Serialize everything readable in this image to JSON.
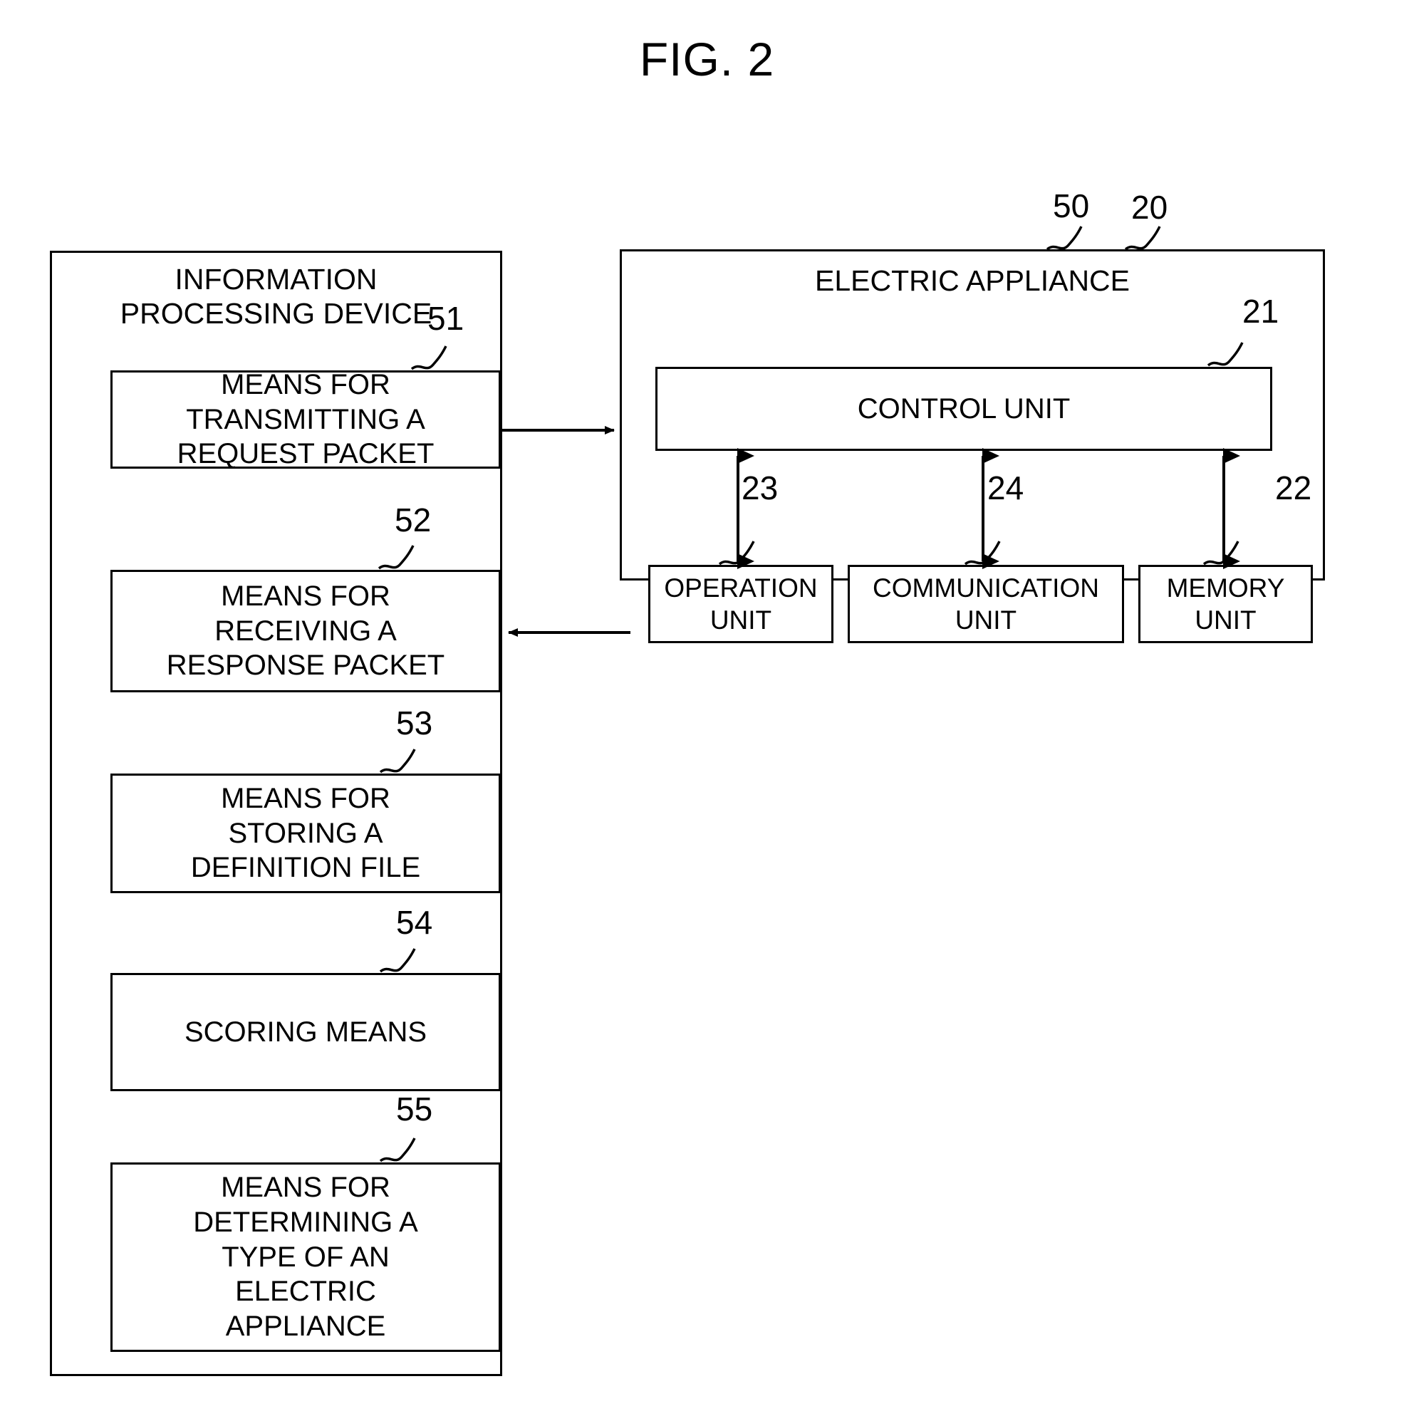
{
  "figure": {
    "title": "FIG. 2",
    "type": "patent-block-diagram"
  },
  "left_panel": {
    "ref": "50",
    "title": "INFORMATION\nPROCESSING DEVICE",
    "boxes": [
      {
        "ref": "51",
        "label": "MEANS FOR\nTRANSMITTING A\nREQUEST PACKET"
      },
      {
        "ref": "52",
        "label": "MEANS FOR\nRECEIVING A\nRESPONSE PACKET"
      },
      {
        "ref": "53",
        "label": "MEANS FOR\nSTORING A\nDEFINITION FILE"
      },
      {
        "ref": "54",
        "label": "SCORING MEANS"
      },
      {
        "ref": "55",
        "label": "MEANS FOR\nDETERMINING A\nTYPE OF AN\nELECTRIC\nAPPLIANCE"
      }
    ]
  },
  "right_panel": {
    "ref": "20",
    "title": "ELECTRIC APPLIANCE",
    "control": {
      "ref": "21",
      "label": "CONTROL UNIT"
    },
    "units": [
      {
        "ref": "23",
        "label": "OPERATION\nUNIT"
      },
      {
        "ref": "24",
        "label": "COMMUNICATION\nUNIT"
      },
      {
        "ref": "22",
        "label": "MEMORY\nUNIT"
      }
    ]
  },
  "connectors": [
    {
      "name": "request-arrow",
      "from": "51",
      "to": "20",
      "direction": "right"
    },
    {
      "name": "response-arrow",
      "from": "20",
      "to": "52",
      "direction": "left"
    },
    {
      "name": "control-operation-link",
      "from": "21",
      "to": "23",
      "direction": "bidirectional"
    },
    {
      "name": "control-communication-link",
      "from": "21",
      "to": "24",
      "direction": "bidirectional"
    },
    {
      "name": "control-memory-link",
      "from": "21",
      "to": "22",
      "direction": "bidirectional"
    }
  ],
  "colors": {
    "ink": "#000000",
    "paper": "#ffffff"
  }
}
